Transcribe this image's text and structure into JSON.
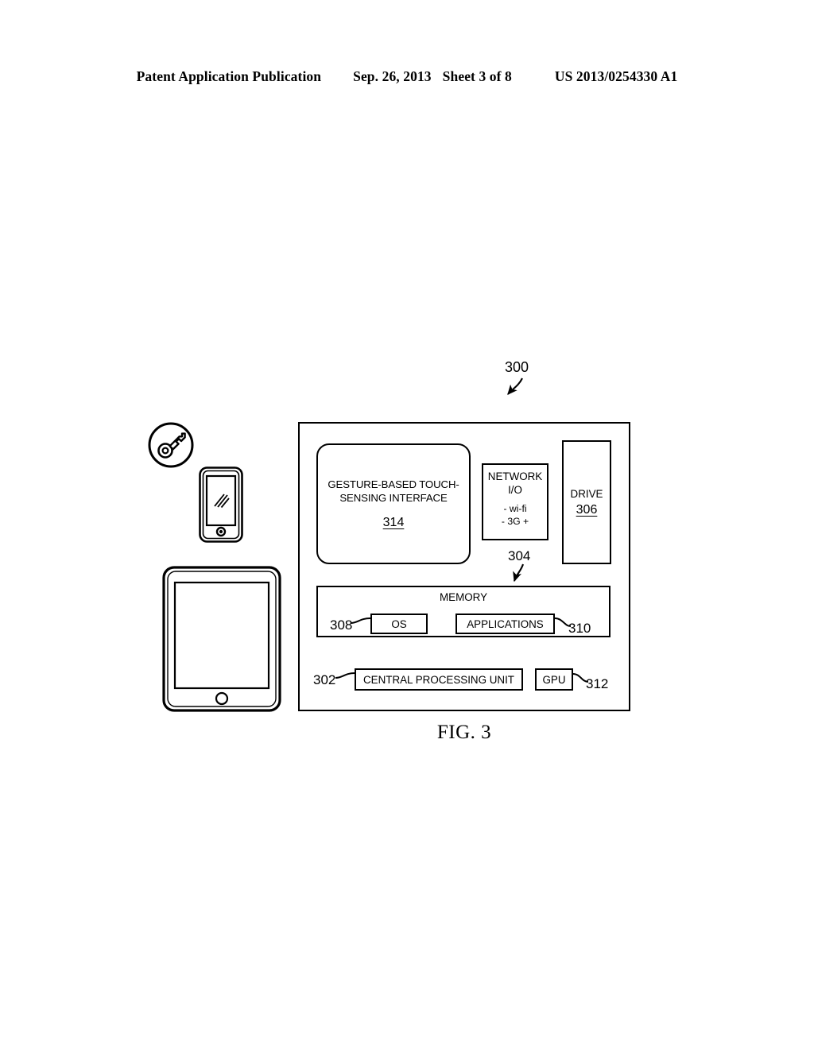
{
  "header": {
    "publication": "Patent Application Publication",
    "date": "Sep. 26, 2013",
    "sheet": "Sheet 3 of 8",
    "patent_number": "US 2013/0254330 A1"
  },
  "figure": {
    "caption": "FIG. 3",
    "system_ref": "300",
    "blocks": {
      "gesture_interface": {
        "title": "GESTURE-BASED TOUCH-SENSING INTERFACE",
        "title_line1": "GESTURE-BASED TOUCH-",
        "title_line2": "SENSING INTERFACE",
        "ref": "314"
      },
      "network_io": {
        "line1": "NETWORK",
        "line2": "I/O",
        "line3": "- wi-fi",
        "line4": "- 3G +",
        "ref": "304"
      },
      "drive": {
        "label": "DRIVE",
        "ref": "306"
      },
      "memory": {
        "label": "MEMORY",
        "ref": "304"
      },
      "os": {
        "label": "OS",
        "ref": "308"
      },
      "applications": {
        "label": "APPLICATIONS",
        "ref": "310"
      },
      "cpu": {
        "label": "CENTRAL PROCESSING UNIT",
        "ref": "302"
      },
      "gpu": {
        "label": "GPU",
        "ref": "312"
      }
    },
    "devices": [
      {
        "name": "key-badge",
        "icon": "key-icon"
      },
      {
        "name": "smartphone",
        "icon": "smartphone-icon"
      },
      {
        "name": "tablet",
        "icon": "tablet-icon"
      }
    ]
  },
  "colors": {
    "ink": "#000000",
    "page": "#ffffff"
  }
}
